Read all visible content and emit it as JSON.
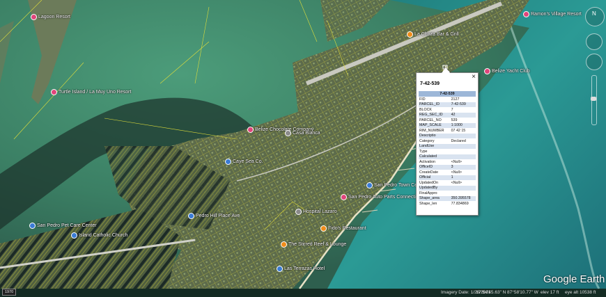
{
  "places": [
    {
      "label": "Lagoon Resort",
      "marker": "pink"
    },
    {
      "label": "Turtle Island / La Muy Uno Resort",
      "marker": "pink"
    },
    {
      "label": "La Choza Bar & Grill",
      "marker": "orange"
    },
    {
      "label": "Ramon's Village Resort",
      "marker": "pink"
    },
    {
      "label": "Belize Yacht Club",
      "marker": "pink"
    },
    {
      "label": "Belize Chocolate Company",
      "marker": "pink"
    },
    {
      "label": "Casa Blanca",
      "marker": "gray"
    },
    {
      "label": "Caye Sea Co.",
      "marker": "blue"
    },
    {
      "label": "San Pedro Town Center",
      "marker": "blue"
    },
    {
      "label": "San Pedro Auto Parts Connection",
      "marker": "pink"
    },
    {
      "label": "Hospital Lazaro",
      "marker": "gray"
    },
    {
      "label": "Pedro Hill Place Ave",
      "marker": "blue"
    },
    {
      "label": "Island Catholic Church",
      "marker": "blue"
    },
    {
      "label": "San Pedro Pet Care Center",
      "marker": "blue"
    },
    {
      "label": "Fido's Restaurant",
      "marker": "orange"
    },
    {
      "label": "The Stirred Reef & Lounge",
      "marker": "orange"
    },
    {
      "label": "Las Terrazas Hotel",
      "marker": "blue"
    }
  ],
  "popup": {
    "title": "7-42-539",
    "table_header": "7-42-539",
    "close_glyph": "×",
    "rows": [
      {
        "field": "FID",
        "value": "2127"
      },
      {
        "field": "PARCEL_ID",
        "value": "7-42-539"
      },
      {
        "field": "BLOCK",
        "value": "7"
      },
      {
        "field": "REG_SEC_ID",
        "value": "42"
      },
      {
        "field": "PARCEL_NO",
        "value": "539"
      },
      {
        "field": "MAP_SCALE",
        "value": "1:1000"
      },
      {
        "field": "RIM_NUMBER",
        "value": "07 42 15"
      },
      {
        "field": "Descriptio",
        "value": ""
      },
      {
        "field": "Category",
        "value": "Declared"
      },
      {
        "field": "LandUse",
        "value": ""
      },
      {
        "field": "Type",
        "value": ""
      },
      {
        "field": "Calculated",
        "value": ""
      },
      {
        "field": "Activation",
        "value": "<Null>"
      },
      {
        "field": "OfficeID",
        "value": "3"
      },
      {
        "field": "CreateDate",
        "value": "<Null>"
      },
      {
        "field": "Official",
        "value": "1"
      },
      {
        "field": "UpdatedOn",
        "value": "<Null>"
      },
      {
        "field": "UpdatedBy",
        "value": ""
      },
      {
        "field": "FinalAppro",
        "value": ""
      },
      {
        "field": "Shape_area",
        "value": "350.395578"
      },
      {
        "field": "Shape_len",
        "value": "77.834869"
      }
    ]
  },
  "controls": {
    "compass_label": "N"
  },
  "scale_legend": "1970",
  "status": {
    "imagery_date": "Imagery Date: 1/26/2021",
    "lat": "17°54'45.63\" N",
    "lon": "87°58'10.77\" W",
    "elev": "elev   17 ft",
    "eye_alt": "eye alt  10538 ft"
  },
  "logo": "Google Earth",
  "colors": {
    "sea": "#2c8f8a",
    "lagoon": "#3c7f68",
    "land": "#5b6a4a",
    "parcel_lines": "#e2df3a",
    "road": "#c9c9c0"
  }
}
